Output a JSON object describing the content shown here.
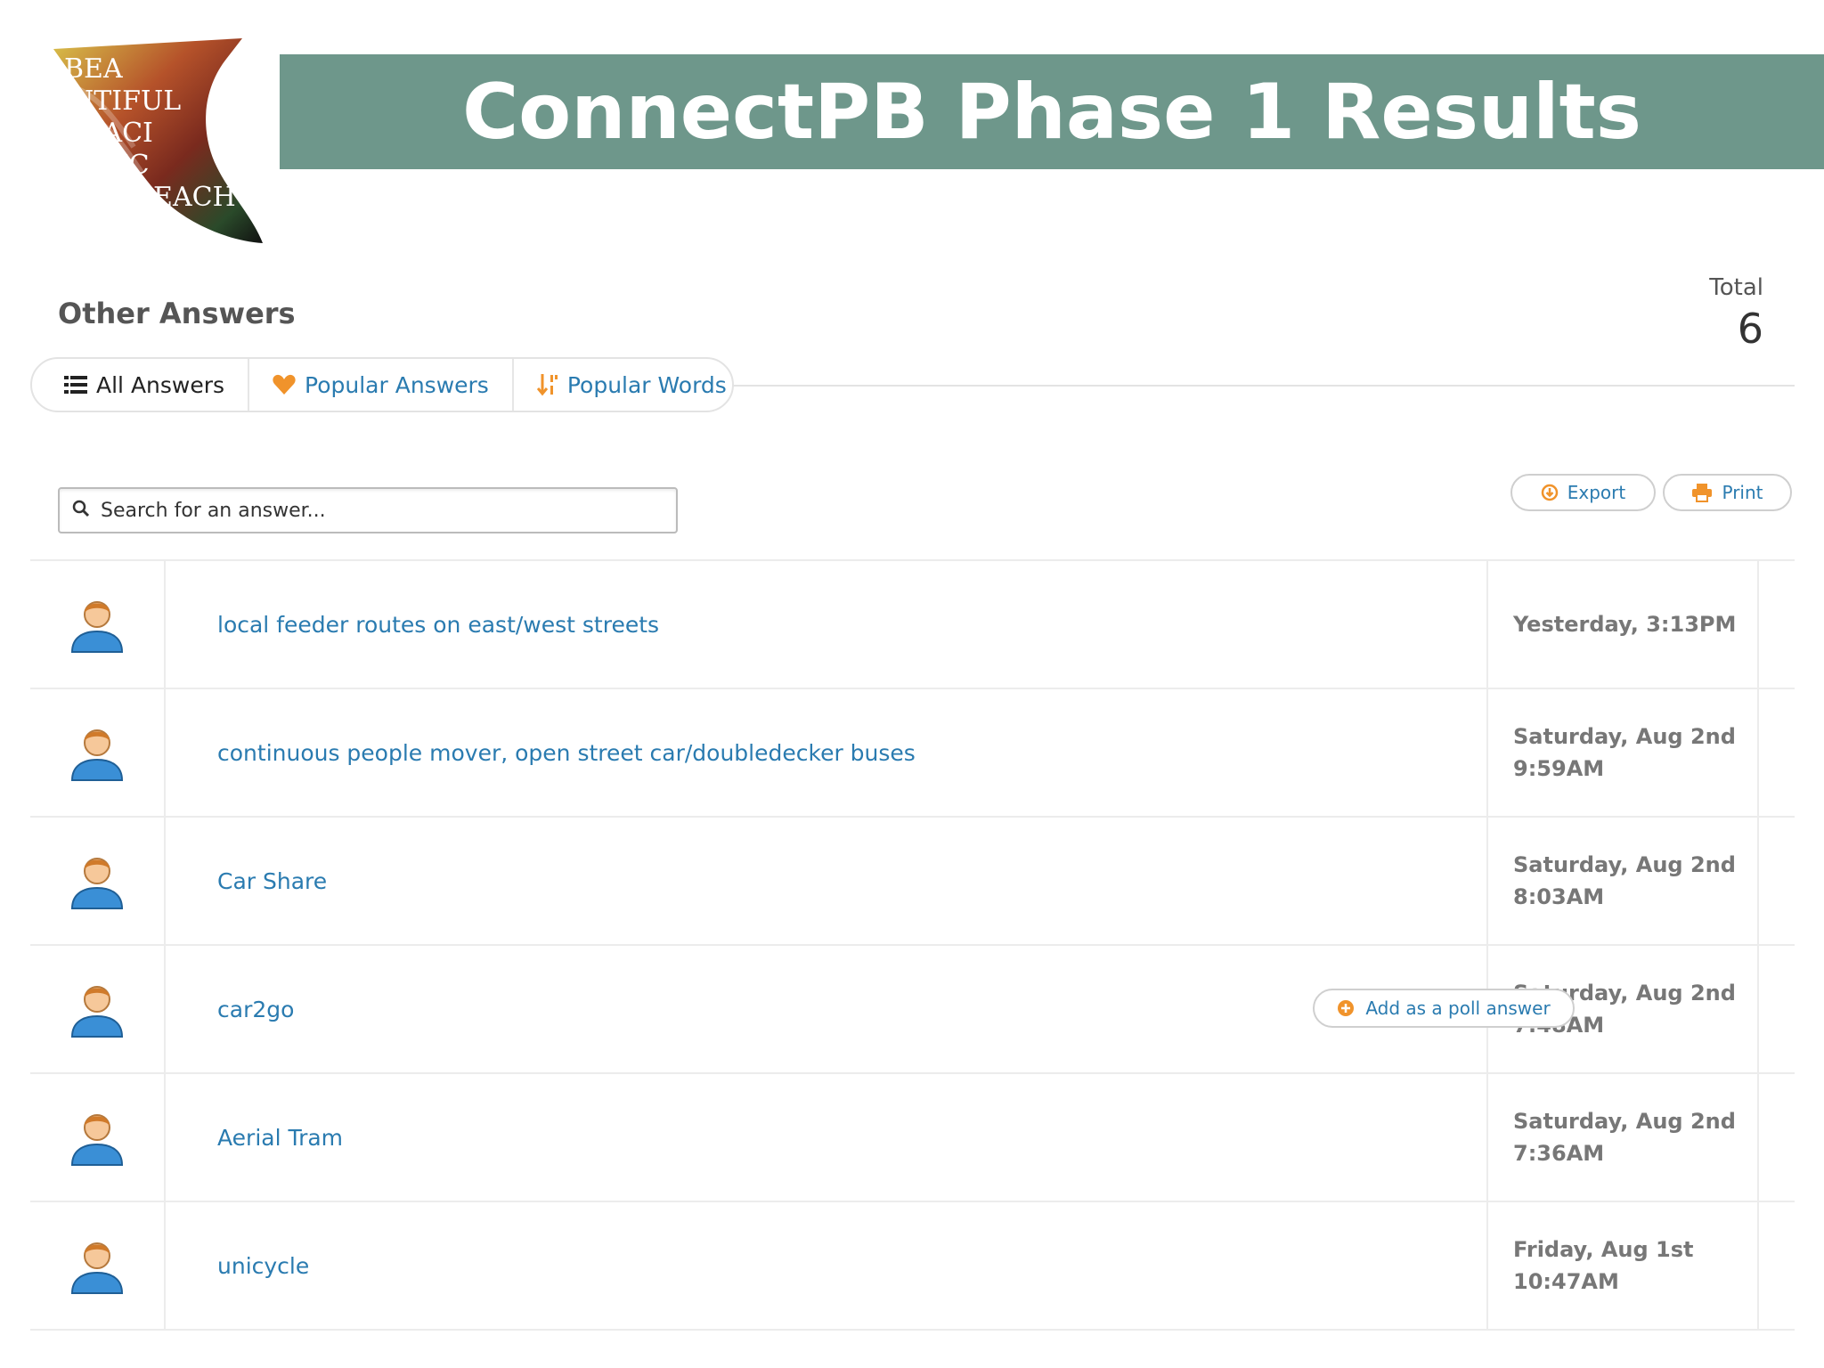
{
  "banner": {
    "title": "ConnectPB Phase 1 Results"
  },
  "logo": {
    "lines": [
      "BEA",
      "UTIFUL",
      "PACI",
      "FIC",
      "BEACH"
    ]
  },
  "section": {
    "title": "Other Answers",
    "total_label": "Total",
    "total_value": "6"
  },
  "tabs": [
    {
      "label": "All Answers",
      "icon": "list-icon",
      "active": true
    },
    {
      "label": "Popular Answers",
      "icon": "heart-icon",
      "active": false
    },
    {
      "label": "Popular Words",
      "icon": "sort-icon",
      "active": false
    }
  ],
  "search": {
    "placeholder": "Search for an answer..."
  },
  "toolbar": {
    "export_label": "Export",
    "print_label": "Print"
  },
  "answers": [
    {
      "text": "local feeder routes on east/west streets",
      "date_line1": "Yesterday, 3:13PM",
      "date_line2": ""
    },
    {
      "text": "continuous people mover, open street car/doubledecker buses",
      "date_line1": "Saturday, Aug 2nd",
      "date_line2": "9:59AM"
    },
    {
      "text": "Car Share",
      "date_line1": "Saturday, Aug 2nd",
      "date_line2": "8:03AM"
    },
    {
      "text": "car2go",
      "date_line1": "Saturday, Aug 2nd",
      "date_line2": "7:48AM",
      "poll_button": "Add as a poll answer"
    },
    {
      "text": "Aerial Tram",
      "date_line1": "Saturday, Aug 2nd",
      "date_line2": "7:36AM"
    },
    {
      "text": "unicycle",
      "date_line1": "Friday, Aug 1st",
      "date_line2": "10:47AM"
    }
  ],
  "colors": {
    "banner": "#6e978b",
    "link": "#2a7bb0",
    "accent_orange": "#f0932b"
  }
}
